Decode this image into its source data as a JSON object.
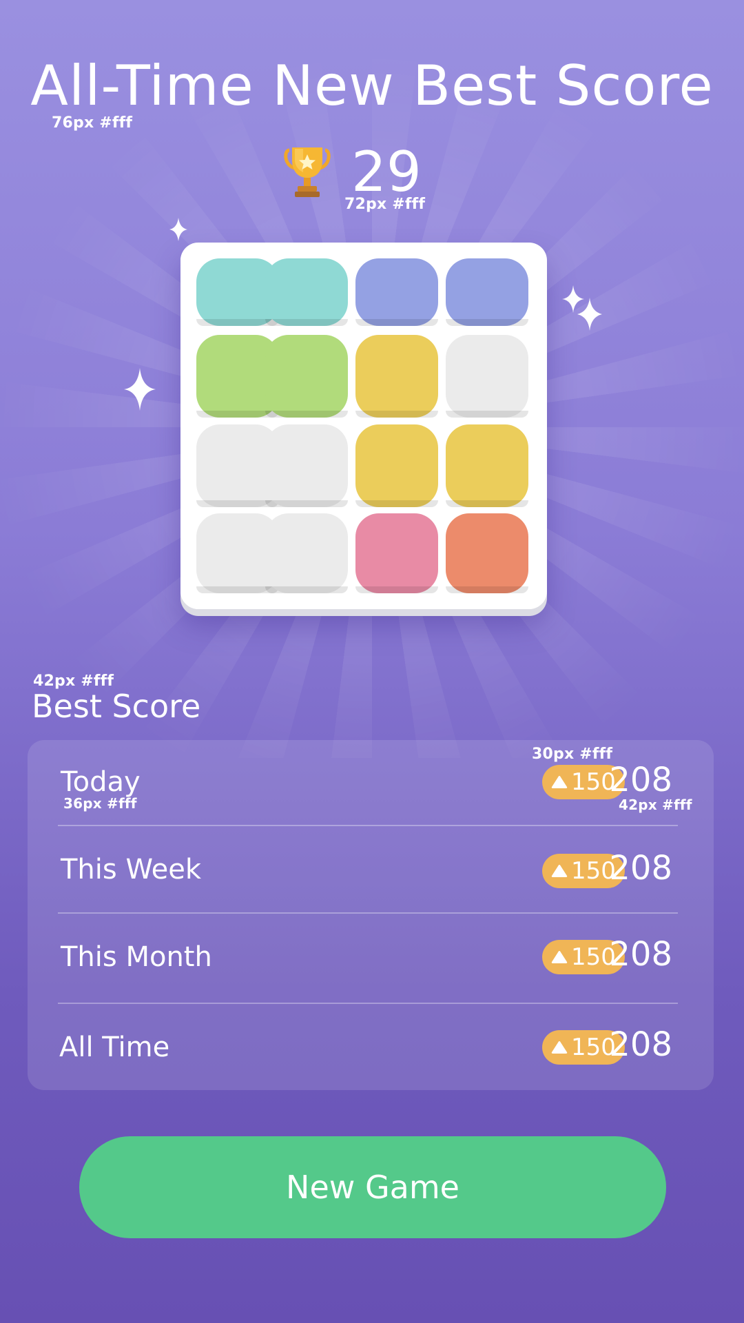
{
  "header": {
    "title": "All-Time New Best Score",
    "title_annotation": "76px #fff",
    "score": "29",
    "score_annotation": "72px #fff"
  },
  "board": {
    "tiles": [
      {
        "color": "#8fd9d4"
      },
      {
        "color": "#8fd9d4"
      },
      {
        "color": "#94a1e3"
      },
      {
        "color": "#94a1e3"
      },
      {
        "color": "#b1db7b"
      },
      {
        "color": "#b1db7b"
      },
      {
        "color": "#ebcd5b"
      },
      {
        "color": "#ebebeb"
      },
      {
        "color": "#ebebeb"
      },
      {
        "color": "#ebebeb"
      },
      {
        "color": "#ebcd5b"
      },
      {
        "color": "#ebcd5b"
      },
      {
        "color": "#ebebeb"
      },
      {
        "color": "#ebebeb"
      },
      {
        "color": "#e88ba5"
      },
      {
        "color": "#ec8b6b"
      }
    ]
  },
  "best_score": {
    "label": "Best Score",
    "label_annotation": "42px #fff",
    "badge_annotation": "30px #fff",
    "row_label_annotation": "36px #fff",
    "value_annotation": "42px #fff",
    "rows": [
      {
        "label": "Today",
        "badge": "150",
        "value": "208"
      },
      {
        "label": "This Week",
        "badge": "150",
        "value": "208"
      },
      {
        "label": "This Month",
        "badge": "150",
        "value": "208"
      },
      {
        "label": "All Time",
        "badge": "150",
        "value": "208"
      }
    ]
  },
  "actions": {
    "new_game": "New Game"
  },
  "icons": {
    "trophy": "trophy-icon",
    "sparkle": "sparkle-icon",
    "badge": "triangle-up-icon"
  },
  "colors": {
    "badge": "#f0b556",
    "button": "#54c98a",
    "background_top": "#9a90e0",
    "background_bottom": "#6750b3"
  }
}
